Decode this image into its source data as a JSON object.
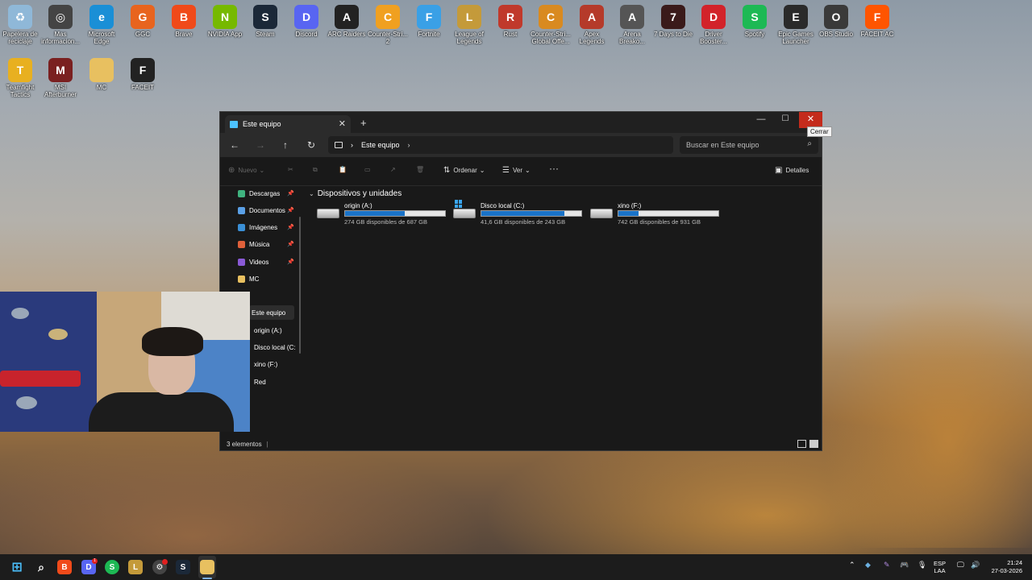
{
  "desktop": {
    "icons": [
      {
        "label": "Papelera de reciclaje",
        "color": "#8fb8d8",
        "glyph": "♻"
      },
      {
        "label": "Mas informacion...",
        "color": "#444444",
        "glyph": "◎"
      },
      {
        "label": "Microsoft Edge",
        "color": "#1a8fd6",
        "glyph": "e"
      },
      {
        "label": "GGC",
        "color": "#e8641e",
        "glyph": "G"
      },
      {
        "label": "Brave",
        "color": "#f04a1a",
        "glyph": "B"
      },
      {
        "label": "NVIDIA App",
        "color": "#76b900",
        "glyph": "N"
      },
      {
        "label": "Steam",
        "color": "#1b2838",
        "glyph": "S"
      },
      {
        "label": "Discord",
        "color": "#5865f2",
        "glyph": "D"
      },
      {
        "label": "ARC Raiders",
        "color": "#222222",
        "glyph": "A"
      },
      {
        "label": "Counter-Stri... 2",
        "color": "#f0a020",
        "glyph": "C"
      },
      {
        "label": "Fortnite",
        "color": "#3aa0e6",
        "glyph": "F"
      },
      {
        "label": "League of Legends",
        "color": "#c49a3a",
        "glyph": "L"
      },
      {
        "label": "Rust",
        "color": "#c0392b",
        "glyph": "R"
      },
      {
        "label": "Counter-Stri... Global Offe...",
        "color": "#d98a20",
        "glyph": "C"
      },
      {
        "label": "Apex Legends",
        "color": "#b53a2a",
        "glyph": "A"
      },
      {
        "label": "Arena Breako...",
        "color": "#555555",
        "glyph": "A"
      },
      {
        "label": "7 Days to Die",
        "color": "#3a1a1a",
        "glyph": "7"
      },
      {
        "label": "Driver Booster...",
        "color": "#d2232a",
        "glyph": "D"
      },
      {
        "label": "Spotify",
        "color": "#1db954",
        "glyph": "S"
      },
      {
        "label": "Epic Games Launcher",
        "color": "#2a2a2a",
        "glyph": "E"
      },
      {
        "label": "OBS Studio",
        "color": "#3a3a3a",
        "glyph": "O"
      },
      {
        "label": "FACEIT AC",
        "color": "#ff5500",
        "glyph": "F"
      },
      {
        "label": "Teamfight Tactics",
        "color": "#e8b020",
        "glyph": "T"
      },
      {
        "label": "MSI Afterburner",
        "color": "#7a2020",
        "glyph": "M"
      },
      {
        "label": "MC",
        "color": "#e8c060",
        "glyph": ""
      },
      {
        "label": "FACEIT",
        "color": "#222222",
        "glyph": "F"
      }
    ]
  },
  "explorer": {
    "tab_title": "Este equipo",
    "tooltip": "Cerrar",
    "address": "Este equipo",
    "search_placeholder": "Buscar en Este equipo",
    "commands": {
      "new": "Nuevo",
      "sort": "Ordenar",
      "view": "Ver",
      "details": "Detalles"
    },
    "nav": [
      {
        "label": "Descargas",
        "color": "#3fb37f",
        "pinned": true
      },
      {
        "label": "Documentos",
        "color": "#5aa0e6",
        "pinned": true
      },
      {
        "label": "Imágenes",
        "color": "#3a8fd6",
        "pinned": true
      },
      {
        "label": "Música",
        "color": "#e0603a",
        "pinned": true
      },
      {
        "label": "Videos",
        "color": "#8a5ad6",
        "pinned": true
      },
      {
        "label": "MC",
        "color": "#e8c060",
        "pinned": false
      },
      {
        "label": "Este equipo",
        "color": "#4cc2ff",
        "pinned": false
      },
      {
        "label": "origin (A:)",
        "color": "#cccccc",
        "pinned": false
      },
      {
        "label": "Disco local (C:",
        "color": "#cccccc",
        "pinned": false
      },
      {
        "label": "xino (F:)",
        "color": "#cccccc",
        "pinned": false
      },
      {
        "label": "Red",
        "color": "#4cc2ff",
        "pinned": false
      }
    ],
    "group_title": "Dispositivos y unidades",
    "drives": [
      {
        "name": "origin (A:)",
        "free": "274 GB disponibles de 687 GB",
        "used_fraction": 0.6,
        "windows": false
      },
      {
        "name": "Disco local (C:)",
        "free": "41,6 GB disponibles de 243 GB",
        "used_fraction": 0.83,
        "windows": true
      },
      {
        "name": "xino (F:)",
        "free": "742 GB disponibles de 931 GB",
        "used_fraction": 0.2,
        "windows": false
      }
    ],
    "status": "3 elementos"
  },
  "taskbar": {
    "lang_line1": "ESP",
    "lang_line2": "LAA",
    "time": "21:24",
    "date": "27-03-2026",
    "discord_badge": "1"
  }
}
